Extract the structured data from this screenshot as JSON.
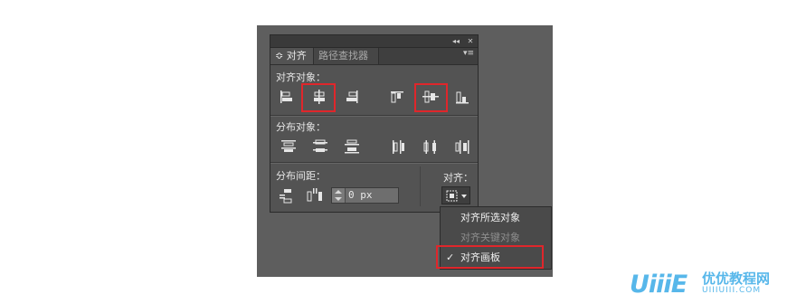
{
  "panel": {
    "collapse_glyph": "◂◂",
    "close_glyph": "✕",
    "tabs": [
      {
        "label": "≎ 对齐",
        "active": true
      },
      {
        "label": "路径查找器",
        "active": false
      }
    ],
    "menu_glyph": "▾≡"
  },
  "align_objects": {
    "label": "对齐对象：",
    "icons": [
      "align-left-icon",
      "align-horizontal-center-icon",
      "align-right-icon",
      "align-top-icon",
      "align-vertical-center-icon",
      "align-bottom-icon"
    ],
    "highlighted": [
      "align-horizontal-center-icon",
      "align-vertical-center-icon"
    ]
  },
  "distribute_objects": {
    "label": "分布对象：",
    "icons": [
      "distribute-top-icon",
      "distribute-vertical-center-icon",
      "distribute-bottom-icon",
      "distribute-left-icon",
      "distribute-horizontal-center-icon",
      "distribute-right-icon"
    ]
  },
  "distribute_spacing": {
    "label": "分布间距：",
    "icons": [
      "distribute-vertical-space-icon",
      "distribute-horizontal-space-icon"
    ],
    "value": "0 px"
  },
  "align_to": {
    "label": "对齐：",
    "button_icon": "align-to-artboard-icon",
    "dropdown": [
      {
        "label": "对齐所选对象",
        "enabled": true,
        "checked": false
      },
      {
        "label": "对齐关键对象",
        "enabled": false,
        "checked": false
      },
      {
        "label": "对齐画板",
        "enabled": true,
        "checked": true
      }
    ],
    "check_glyph": "✓"
  },
  "watermark": {
    "logo": "UiiiE",
    "cn": "优优教程网",
    "url": "UIIIUIII.COM"
  },
  "colors": {
    "panel": "#535353",
    "highlight": "#e0262b",
    "watermark": "#57b7ea"
  }
}
